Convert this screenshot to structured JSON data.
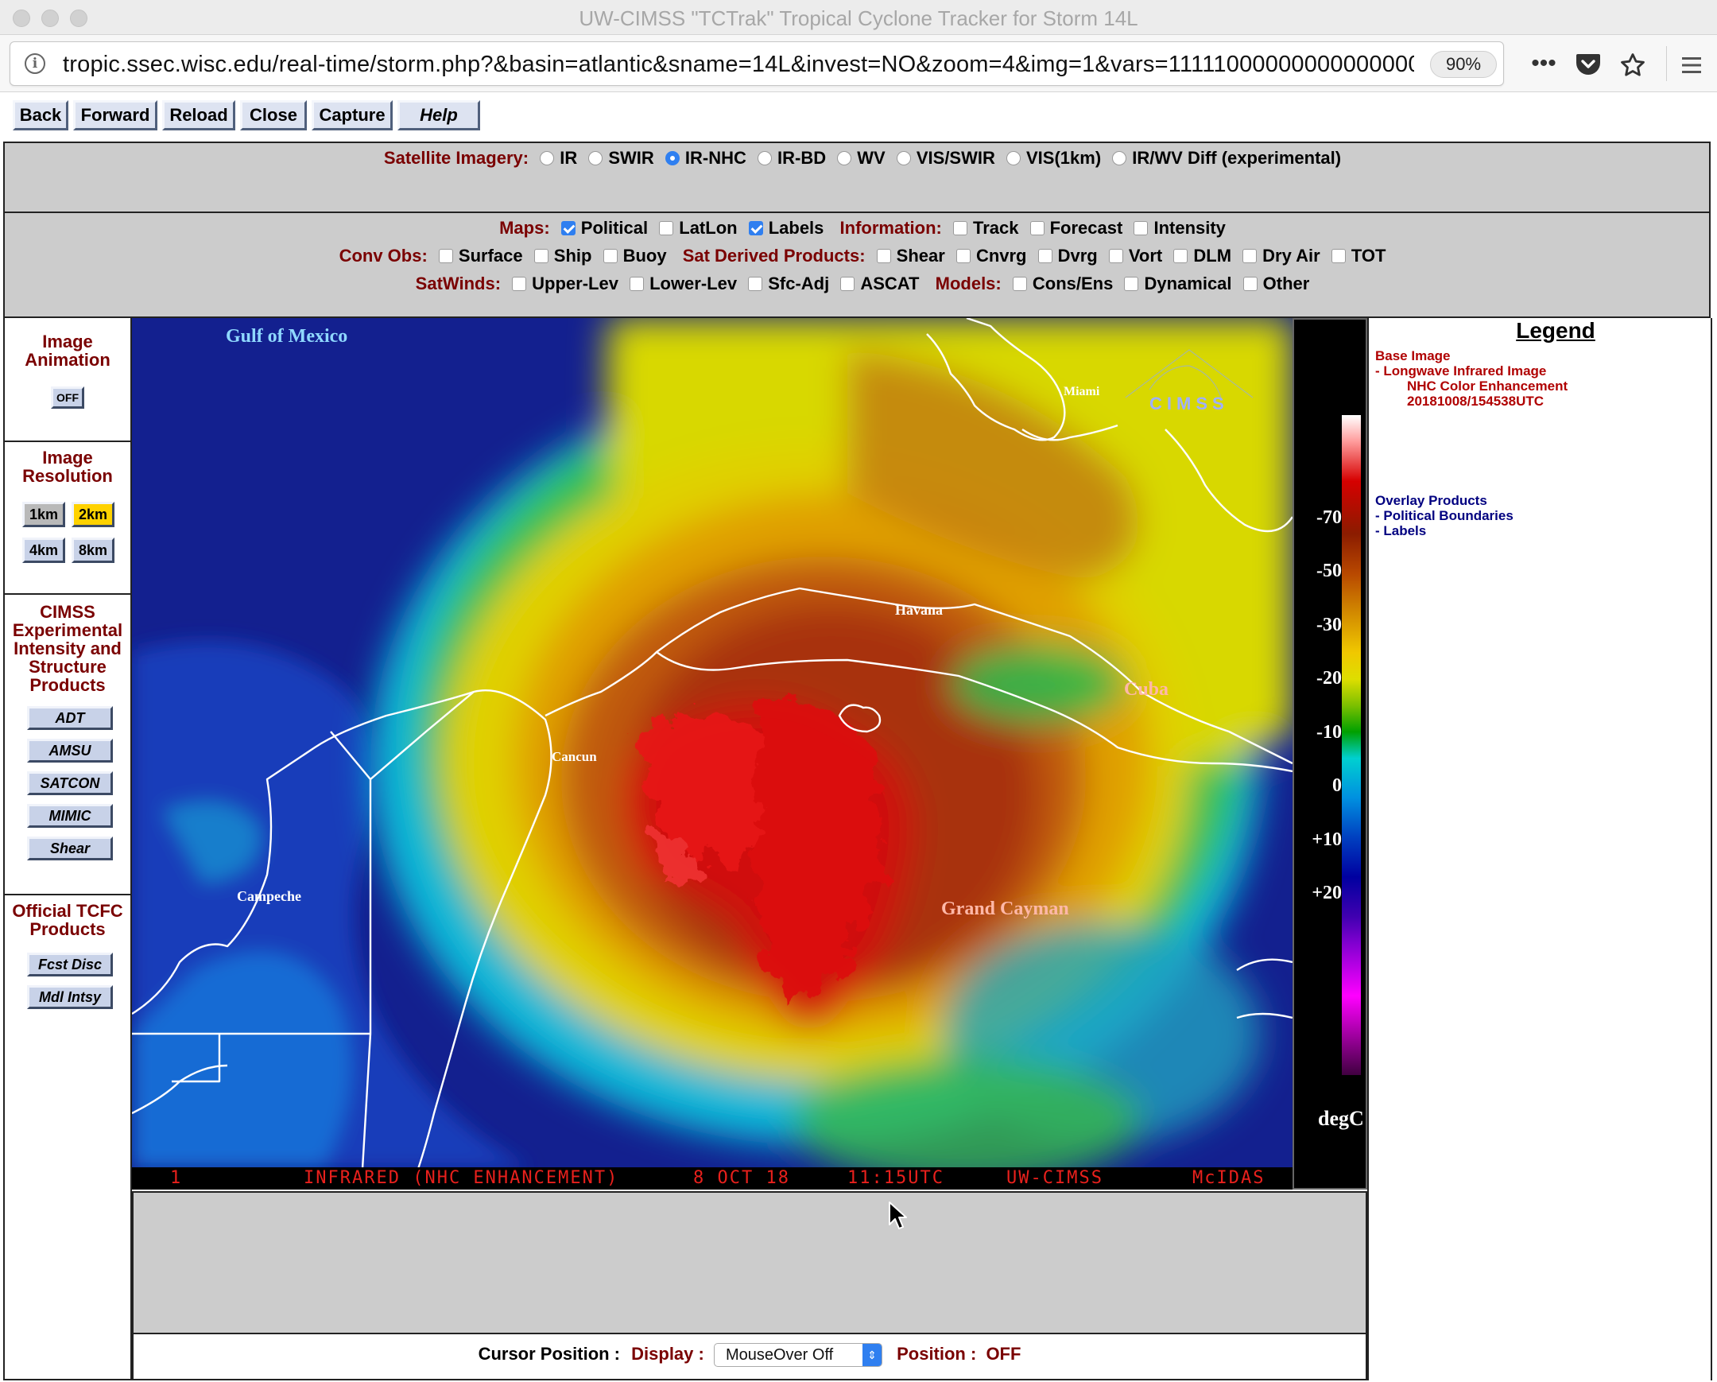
{
  "window": {
    "title": "UW-CIMSS \"TCTrak\" Tropical Cyclone Tracker for Storm 14L"
  },
  "browser": {
    "url": "tropic.ssec.wisc.edu/real-time/storm.php?&basin=atlantic&sname=14L&invest=NO&zoom=4&img=1&vars=11111000000000000000",
    "zoom": "90%",
    "icons": [
      "info-icon",
      "more-icon",
      "pocket-icon",
      "star-icon",
      "hamburger-menu-icon"
    ]
  },
  "toolbar": {
    "back": "Back",
    "forward": "Forward",
    "reload": "Reload",
    "close": "Close",
    "capture": "Capture",
    "help": "Help"
  },
  "satellite": {
    "label": "Satellite Imagery:",
    "options": [
      {
        "label": "IR",
        "selected": false
      },
      {
        "label": "SWIR",
        "selected": false
      },
      {
        "label": "IR-NHC",
        "selected": true
      },
      {
        "label": "IR-BD",
        "selected": false
      },
      {
        "label": "WV",
        "selected": false
      },
      {
        "label": "VIS/SWIR",
        "selected": false
      },
      {
        "label": "VIS(1km)",
        "selected": false
      },
      {
        "label": "IR/WV Diff (experimental)",
        "selected": false
      }
    ]
  },
  "overlays": {
    "maps_label": "Maps:",
    "maps": [
      {
        "label": "Political",
        "checked": true
      },
      {
        "label": "LatLon",
        "checked": false
      },
      {
        "label": "Labels",
        "checked": true
      }
    ],
    "information_label": "Information:",
    "information": [
      {
        "label": "Track",
        "checked": false
      },
      {
        "label": "Forecast",
        "checked": false
      },
      {
        "label": "Intensity",
        "checked": false
      }
    ],
    "conv_obs_label": "Conv Obs:",
    "conv_obs": [
      {
        "label": "Surface",
        "checked": false
      },
      {
        "label": "Ship",
        "checked": false
      },
      {
        "label": "Buoy",
        "checked": false
      }
    ],
    "sat_derived_label": "Sat Derived Products:",
    "sat_derived": [
      {
        "label": "Shear",
        "checked": false
      },
      {
        "label": "Cnvrg",
        "checked": false
      },
      {
        "label": "Dvrg",
        "checked": false
      },
      {
        "label": "Vort",
        "checked": false
      },
      {
        "label": "DLM",
        "checked": false
      },
      {
        "label": "Dry Air",
        "checked": false
      },
      {
        "label": "TOT",
        "checked": false
      }
    ],
    "satwinds_label": "SatWinds:",
    "satwinds": [
      {
        "label": "Upper-Lev",
        "checked": false
      },
      {
        "label": "Lower-Lev",
        "checked": false
      },
      {
        "label": "Sfc-Adj",
        "checked": false
      },
      {
        "label": "ASCAT",
        "checked": false
      }
    ],
    "models_label": "Models:",
    "models": [
      {
        "label": "Cons/Ens",
        "checked": false
      },
      {
        "label": "Dynamical",
        "checked": false
      },
      {
        "label": "Other",
        "checked": false
      }
    ]
  },
  "sidebar": {
    "animation_title_1": "Image",
    "animation_title_2": "Animation",
    "animation_button": "OFF",
    "resolution_title_1": "Image",
    "resolution_title_2": "Resolution",
    "res_1km": "1km",
    "res_2km": "2km",
    "res_4km": "4km",
    "res_8km": "8km",
    "res_selected": "2km",
    "cimss_title": [
      "CIMSS",
      "Experimental",
      "Intensity and",
      "Structure",
      "Products"
    ],
    "cimss_buttons": [
      "ADT",
      "AMSU",
      "SATCON",
      "MIMIC",
      "Shear"
    ],
    "tcfc_title": [
      "Official TCFC",
      "Products"
    ],
    "tcfc_buttons": [
      "Fcst Disc",
      "Mdl Intsy"
    ]
  },
  "image": {
    "labels": {
      "gulf": "Gulf of Mexico",
      "miami": "Miami",
      "havana": "Havana",
      "cuba": "Cuba",
      "cancun": "Cancun",
      "campeche": "Campeche",
      "grand_cayman": "Grand Cayman"
    },
    "logo": "CIMSS",
    "caption": {
      "frame": "1",
      "product": "INFRARED (NHC ENHANCEMENT)",
      "date": "8 OCT 18",
      "time": "11:15UTC",
      "source": "UW-CIMSS",
      "software": "McIDAS"
    }
  },
  "colorbar": {
    "ticks": [
      "-70",
      "-50",
      "-30",
      "-20",
      "-10",
      "0",
      "+10",
      "+20"
    ],
    "unit": "degC"
  },
  "legend": {
    "title": "Legend",
    "base_label": "Base Image",
    "base_lines": [
      "-  Longwave Infrared Image",
      "NHC Color Enhancement",
      "20181008/154538UTC"
    ],
    "overlay_label": "Overlay Products",
    "overlay_lines": [
      "-  Political Boundaries",
      "-  Labels"
    ]
  },
  "cursor": {
    "label": "Cursor Position :",
    "display_label": "Display :",
    "display_value": "MouseOver Off",
    "position_label": "Position :",
    "position_value": "OFF"
  },
  "colors": {
    "button_face": "#dde3f1",
    "label_dark_red": "#7a0000",
    "legend_blue": "#000080",
    "selected_yellow": "#ffd200",
    "checkbox_blue": "#2f7ff0"
  }
}
